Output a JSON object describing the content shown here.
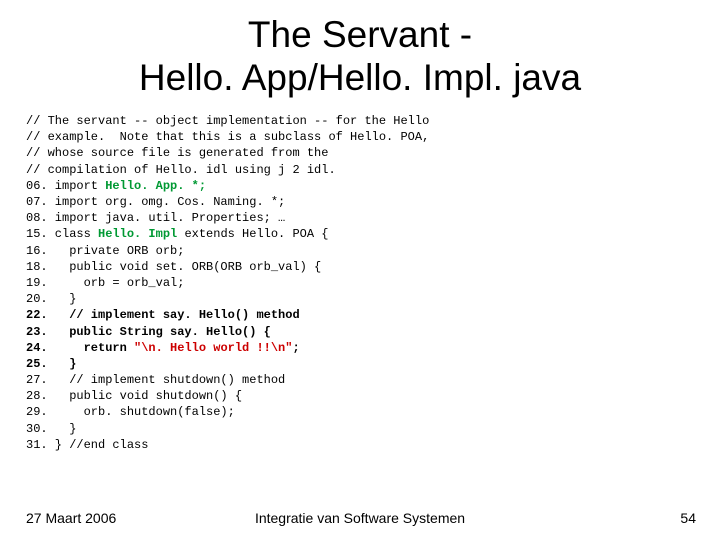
{
  "title_line1": "The Servant -",
  "title_line2": "Hello. App/Hello. Impl. java",
  "code": {
    "c01": "// The servant -- object implementation -- for the Hello",
    "c02": "// example.  Note that this is a subclass of Hello. POA,",
    "c03": "// whose source file is generated from the",
    "c04": "// compilation of Hello. idl using j 2 idl.",
    "l06a": "06. import ",
    "l06b": "Hello. App. *;",
    "l07": "07. import org. omg. Cos. Naming. *;",
    "l08": "08. import java. util. Properties; …",
    "l15a": "15. class ",
    "l15b": "Hello. Impl ",
    "l15c": "extends Hello. POA {",
    "l16": "16.   private ORB orb;",
    "l18": "18.   public void set. ORB(ORB orb_val) {",
    "l19": "19.     orb = orb_val;",
    "l20": "20.   }",
    "l22": "22.   // implement say. Hello() method",
    "l23": "23.   public String say. Hello() {",
    "l24": "24.     return \"\\n. Hello world !!\\n\";",
    "l25": "25.   }",
    "l27": "27.   // implement shutdown() method",
    "l28": "28.   public void shutdown() {",
    "l29": "29.     orb. shutdown(false);",
    "l30": "30.   }",
    "l31": "31. } //end class"
  },
  "footer": {
    "date": "27 Maart 2006",
    "center": "Integratie van Software Systemen",
    "page": "54"
  }
}
